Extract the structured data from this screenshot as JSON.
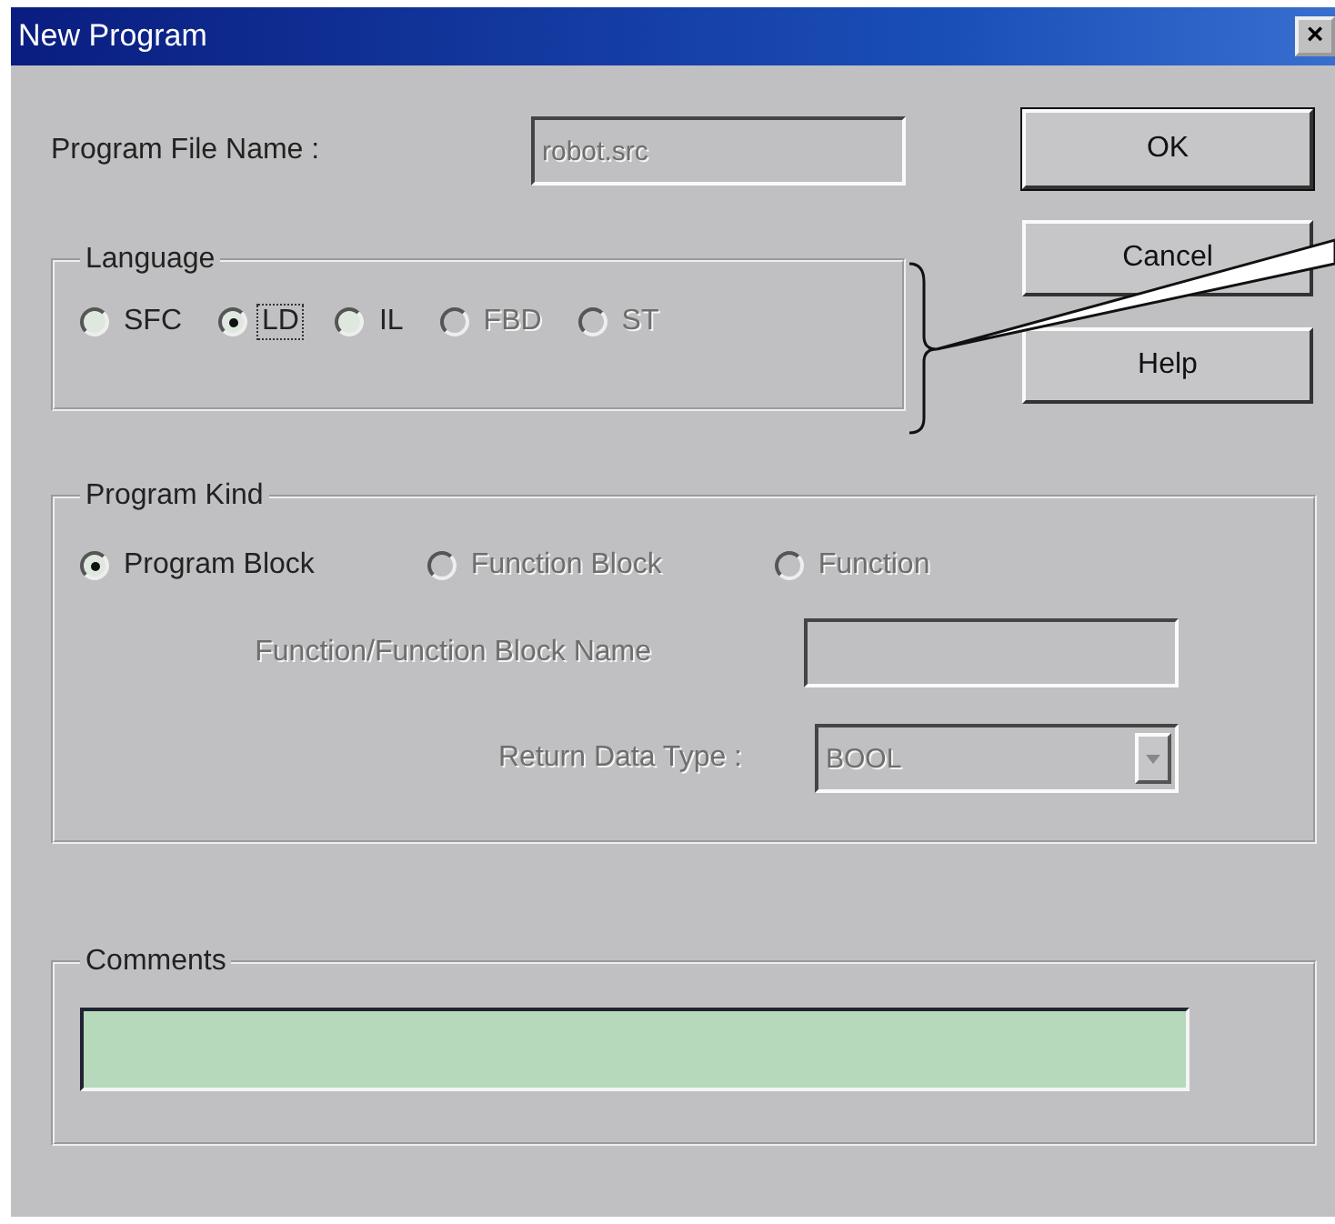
{
  "window": {
    "title": "New Program",
    "close": "×"
  },
  "file_name": {
    "label": "Program File Name :",
    "value": "robot.src",
    "disabled": true
  },
  "buttons": [
    {
      "label": "OK",
      "default": true
    },
    {
      "label": "Cancel",
      "default": false
    },
    {
      "label": "Help",
      "default": false
    }
  ],
  "language": {
    "title": "Language",
    "options": [
      {
        "label": "SFC",
        "selected": false,
        "disabled": false,
        "focused": false
      },
      {
        "label": "LD",
        "selected": true,
        "disabled": false,
        "focused": true
      },
      {
        "label": "IL",
        "selected": false,
        "disabled": false,
        "focused": false
      },
      {
        "label": "FBD",
        "selected": false,
        "disabled": true,
        "focused": false
      },
      {
        "label": "ST",
        "selected": false,
        "disabled": true,
        "focused": false
      }
    ]
  },
  "program_kind": {
    "title": "Program Kind",
    "options": [
      {
        "label": "Program Block",
        "selected": true,
        "disabled": false
      },
      {
        "label": "Function Block",
        "selected": false,
        "disabled": true
      },
      {
        "label": "Function",
        "selected": false,
        "disabled": true
      }
    ],
    "name_field": {
      "label": "Function/Function Block Name",
      "disabled": true
    },
    "return_type": {
      "label": "Return Data Type :",
      "value": "BOOL",
      "disabled": true
    }
  },
  "comments": {
    "title": "Comments"
  }
}
